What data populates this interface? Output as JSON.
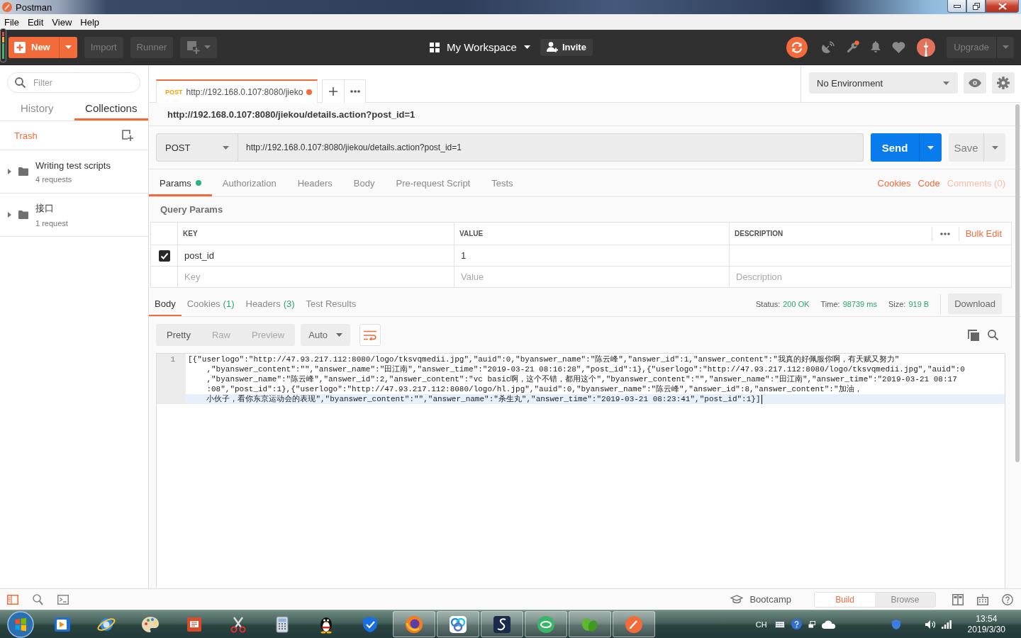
{
  "window": {
    "title": "Postman",
    "menu": [
      "File",
      "Edit",
      "View",
      "Help"
    ]
  },
  "header": {
    "new_button": "New",
    "buttons": [
      "Import",
      "Runner"
    ],
    "workspace": "My Workspace",
    "invite": "Invite",
    "upgrade": "Upgrade"
  },
  "sidebar": {
    "filter_placeholder": "Filter",
    "tabs": [
      {
        "label": "History",
        "selected": false
      },
      {
        "label": "Collections",
        "selected": true
      }
    ],
    "trash": "Trash",
    "collections": [
      {
        "name": "Writing test scripts",
        "count": "4 requests",
        "expanded": false
      },
      {
        "name": "接口",
        "count": "1 request",
        "expanded": false
      }
    ]
  },
  "request_tabs": [
    {
      "method": "POST",
      "title": "http://192.168.0.107:8080/jieko",
      "unsaved": true,
      "selected": true
    }
  ],
  "environment": "No Environment",
  "request": {
    "name": "http://192.168.0.107:8080/jiekou/details.action?post_id=1",
    "method": "POST",
    "url": "http://192.168.0.107:8080/jiekou/details.action?post_id=1",
    "send": "Send",
    "save": "Save"
  },
  "request_options": {
    "tabs": [
      {
        "label": "Params",
        "selected": true,
        "has_content": true
      },
      {
        "label": "Authorization",
        "selected": false,
        "has_content": false
      },
      {
        "label": "Headers",
        "selected": false,
        "has_content": false
      },
      {
        "label": "Body",
        "selected": false,
        "has_content": false
      },
      {
        "label": "Pre-request Script",
        "selected": false,
        "has_content": false
      },
      {
        "label": "Tests",
        "selected": false,
        "has_content": false
      }
    ],
    "links": [
      {
        "label": "Cookies",
        "disabled": false
      },
      {
        "label": "Code",
        "disabled": false
      },
      {
        "label": "Comments (0)",
        "disabled": true
      }
    ]
  },
  "params": {
    "title": "Query Params",
    "columns": [
      "KEY",
      "VALUE",
      "DESCRIPTION"
    ],
    "bulk_edit": "Bulk Edit",
    "rows": [
      {
        "checked": true,
        "key": "post_id",
        "value": "1"
      }
    ],
    "new_row": {
      "key": {
        "placeholder": "Key"
      },
      "value": {
        "placeholder": "Value"
      },
      "description": {
        "placeholder": "Description"
      }
    }
  },
  "response": {
    "tabs": [
      {
        "label": "Body",
        "selected": true
      },
      {
        "label": "Cookies",
        "count": "(1)",
        "selected": false
      },
      {
        "label": "Headers",
        "count": "(3)",
        "selected": false
      },
      {
        "label": "Test Results",
        "selected": false
      }
    ],
    "stats": [
      {
        "label": "Status:",
        "value": "200 OK"
      },
      {
        "label": "Time:",
        "value": "98739 ms"
      },
      {
        "label": "Size:",
        "value": "919 B"
      }
    ],
    "download": "Download",
    "views": [
      {
        "label": "Pretty",
        "selected": true
      },
      {
        "label": "Raw",
        "selected": false
      },
      {
        "label": "Preview",
        "selected": false
      }
    ],
    "format": "Auto",
    "wrap_lines": true,
    "body": {
      "line_number": "1",
      "lines": [
        "[{\"userlogo\":\"http://47.93.217.112:8080/logo/tksvqmedii.jpg\",\"auid\":0,\"byanswer_name\":\"陈云峰\",\"answer_id\":1,\"answer_content\":\"我真的好佩服你啊，有天赋又努力\"",
        ",\"byanswer_content\":\"\",\"answer_name\":\"田江南\",\"answer_time\":\"2019-03-21 08:16:28\",\"post_id\":1},{\"userlogo\":\"http://47.93.217.112:8080/logo/tksvqmedii.jpg\",\"auid\":0",
        ",\"byanswer_name\":\"陈云峰\",\"answer_id\":2,\"answer_content\":\"vc basic啊，这个不错，都用这个\",\"byanswer_content\":\"\",\"answer_name\":\"田江南\",\"answer_time\":\"2019-03-21 08:17",
        ":08\",\"post_id\":1},{\"userlogo\":\"http://47.93.217.112:8080/logo/hl.jpg\",\"auid\":0,\"byanswer_name\":\"陈云峰\",\"answer_id\":8,\"answer_content\":\"加油，",
        "小伙子，看你东京运动会的表现\",\"byanswer_content\":\"\",\"answer_name\":\"杀生丸\",\"answer_time\":\"2019-03-21 08:23:41\",\"post_id\":1}]"
      ]
    }
  },
  "status_bar": {
    "bootcamp": "Bootcamp",
    "modes": [
      {
        "label": "Build",
        "selected": true
      },
      {
        "label": "Browse",
        "selected": false
      }
    ]
  },
  "taskbar": {
    "apps": [
      {
        "kind": "media",
        "running": false
      },
      {
        "kind": "globe",
        "running": false
      },
      {
        "kind": "palette",
        "running": false
      },
      {
        "kind": "slides",
        "running": false
      },
      {
        "kind": "scissors",
        "running": false
      },
      {
        "kind": "calculator",
        "running": false
      },
      {
        "kind": "penguin",
        "running": false
      },
      {
        "kind": "shield",
        "running": false
      },
      {
        "kind": "fox",
        "running": true
      },
      {
        "kind": "rings",
        "running": true
      },
      {
        "kind": "swoosh",
        "running": true
      },
      {
        "kind": "disc",
        "running": true
      },
      {
        "kind": "leaf",
        "running": true
      },
      {
        "kind": "pen",
        "running": true
      }
    ],
    "tray": {
      "language": "CH",
      "time": "13:54",
      "date": "2019/3/30"
    }
  }
}
